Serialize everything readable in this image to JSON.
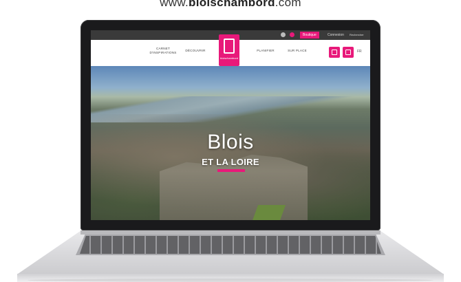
{
  "url": {
    "prefix": "www.",
    "domain": "bloischambord",
    "suffix": ".com"
  },
  "topbar": {
    "button_active": "Boutique",
    "button_2": "Connexion",
    "button_3": "Rechercher un séjour"
  },
  "nav": {
    "item_1": "CARNET\nD'INSPIRATIONS",
    "item_2": "DÉCOUVRIR",
    "item_3": "PLANIFIER",
    "item_4": "SUR PLACE",
    "lang": "FR"
  },
  "logo": {
    "text": "bloischambord",
    "tagline": "BLOIS\nCHAMBORD"
  },
  "hero": {
    "title": "Blois",
    "subtitle": "ET LA LOIRE"
  },
  "colors": {
    "accent": "#e8197a",
    "bezel": "#1a1a1c",
    "body": "#d7d7da"
  }
}
